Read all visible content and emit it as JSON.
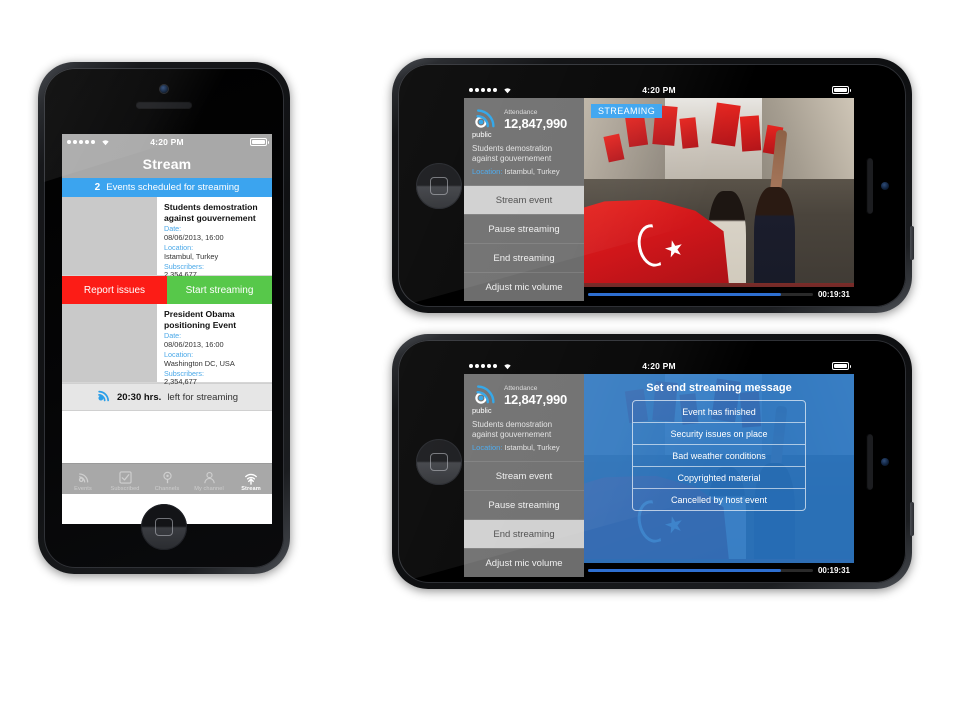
{
  "statusbar": {
    "time": "4:20 PM",
    "signal_dots": 5,
    "wifi_icon": "wifi-icon",
    "battery_icon": "battery-full-icon"
  },
  "phone1": {
    "nav_title": "Stream",
    "section": {
      "count": "2",
      "label": "Events scheduled for streaming"
    },
    "events": [
      {
        "title": "Students demostration against gouvernement",
        "date_label": "Date:",
        "date_value": "08/06/2013, 16:00",
        "location_label": "Location:",
        "location_value": "Istambul, Turkey",
        "subscribers_label": "Subscribers:",
        "subscribers_value": "2,354,677"
      },
      {
        "title": "President Obama positioning Event",
        "date_label": "Date:",
        "date_value": "08/06/2013, 16:00",
        "location_label": "Location:",
        "location_value": "Washington DC, USA",
        "subscribers_label": "Subscribers:",
        "subscribers_value": "2,354,677"
      }
    ],
    "buttons": {
      "report": "Report issues",
      "start": "Start streaming"
    },
    "timer": {
      "icon": "broadcast-icon",
      "value": "20:30 hrs.",
      "text": "left for streaming"
    },
    "tabs": [
      {
        "label": "Events",
        "icon": "broadcast-icon",
        "active": false
      },
      {
        "label": "Subscribed",
        "icon": "checkbox-icon",
        "active": false
      },
      {
        "label": "Channels",
        "icon": "microphone-icon",
        "active": false
      },
      {
        "label": "My channel",
        "icon": "person-icon",
        "active": false
      },
      {
        "label": "Stream",
        "icon": "upload-broadcast-icon",
        "active": true
      }
    ]
  },
  "phone2": {
    "sidebar": {
      "logo_icon": "broadcast-icon",
      "public_label": "public",
      "attendance_label": "Attendance",
      "attendance_value": "12,847,990",
      "event_title": "Students demostration against gouvernement",
      "location_label": "Location:",
      "location_value": "Istambul, Turkey",
      "menu": [
        {
          "label": "Stream event",
          "selected": true
        },
        {
          "label": "Pause streaming",
          "selected": false
        },
        {
          "label": "End streaming",
          "selected": false
        },
        {
          "label": "Adjust mic volume",
          "selected": false
        }
      ]
    },
    "video": {
      "badge": "STREAMING",
      "elapsed": "00:19:31",
      "progress_percent": 86
    }
  },
  "phone3": {
    "sidebar": {
      "logo_icon": "broadcast-icon",
      "public_label": "public",
      "attendance_label": "Attendance",
      "attendance_value": "12,847,990",
      "event_title": "Students demostration against gouvernement",
      "location_label": "Location:",
      "location_value": "Istambul, Turkey",
      "menu": [
        {
          "label": "Stream event",
          "selected": false
        },
        {
          "label": "Pause streaming",
          "selected": false
        },
        {
          "label": "End streaming",
          "selected": true
        },
        {
          "label": "Adjust mic volume",
          "selected": false
        }
      ]
    },
    "video": {
      "elapsed": "00:19:31",
      "progress_percent": 86
    },
    "dialog": {
      "title": "Set end streaming message",
      "options": [
        "Event has finished",
        "Security issues on place",
        "Bad weather conditions",
        "Copyrighted material",
        "Cancelled by host event"
      ]
    }
  },
  "colors": {
    "accent_blue": "#3ba4ef",
    "danger_red": "#fc1c16",
    "success_green": "#57c84a",
    "chrome_gray": "#a8a8a8",
    "sidebar_gray": "#6d6d6d"
  }
}
